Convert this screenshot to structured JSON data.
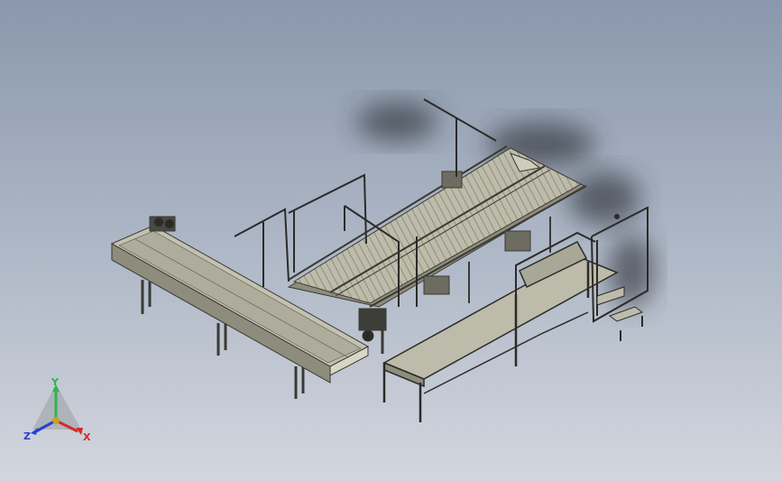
{
  "viewport": {
    "background_top": "#8a98ad",
    "background_bottom": "#d2d6de",
    "model_color": "#b3b1a0",
    "shadow_color": "#2e3238"
  },
  "triad": {
    "x_label": "X",
    "y_label": "Y",
    "z_label": "Z",
    "x_color": "#d42a2a",
    "y_color": "#2fb54a",
    "z_color": "#2a3fd4"
  }
}
